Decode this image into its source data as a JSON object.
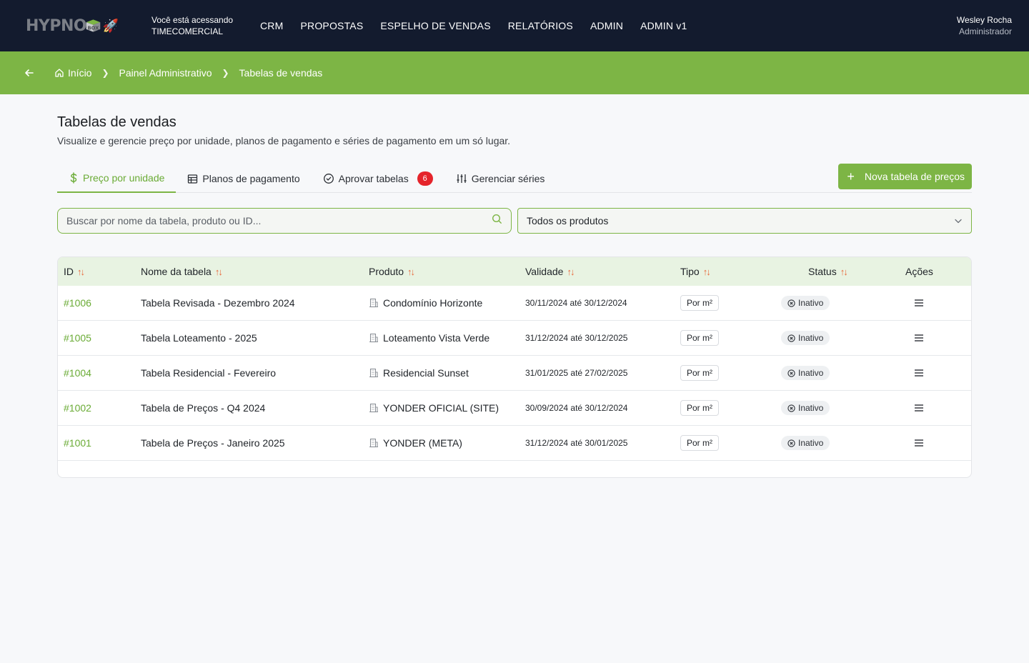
{
  "header": {
    "logo_alt": "HYPNOBOX",
    "access_line1": "Você está acessando",
    "access_line2": "TIMECOMERCIAL",
    "nav": [
      "CRM",
      "PROPOSTAS",
      "ESPELHO DE VENDAS",
      "RELATÓRIOS",
      "ADMIN",
      "ADMIN v1"
    ],
    "user_name": "Wesley Rocha",
    "user_role": "Administrador"
  },
  "breadcrumb": [
    "Início",
    "Painel Administrativo",
    "Tabelas de vendas"
  ],
  "page": {
    "title": "Tabelas de vendas",
    "subtitle": "Visualize e gerencie preço por unidade, planos de pagamento e séries de pagamento em um só lugar."
  },
  "tabs": [
    {
      "label": "Preço por unidade",
      "icon": "dollar-icon",
      "active": true
    },
    {
      "label": "Planos de pagamento",
      "icon": "table-icon",
      "active": false
    },
    {
      "label": "Aprovar tabelas",
      "icon": "check-circle-icon",
      "active": false,
      "badge": "6"
    },
    {
      "label": "Gerenciar séries",
      "icon": "sliders-icon",
      "active": false
    }
  ],
  "new_button": "Nova tabela de preços",
  "search": {
    "placeholder": "Buscar por nome da tabela, produto ou ID..."
  },
  "product_filter": {
    "selected": "Todos os produtos"
  },
  "table": {
    "columns": [
      "ID",
      "Nome da tabela",
      "Produto",
      "Validade",
      "Tipo",
      "Status",
      "Ações"
    ],
    "rows": [
      {
        "id": "#1006",
        "name": "Tabela Revisada - Dezembro 2024",
        "product": "Condomínio Horizonte",
        "validity": "30/11/2024 até 30/12/2024",
        "type": "Por m²",
        "status": "Inativo"
      },
      {
        "id": "#1005",
        "name": "Tabela Loteamento - 2025",
        "product": "Loteamento Vista Verde",
        "validity": "31/12/2024 até 30/12/2025",
        "type": "Por m²",
        "status": "Inativo"
      },
      {
        "id": "#1004",
        "name": "Tabela Residencial - Fevereiro",
        "product": "Residencial Sunset",
        "validity": "31/01/2025 até 27/02/2025",
        "type": "Por m²",
        "status": "Inativo"
      },
      {
        "id": "#1002",
        "name": "Tabela de Preços - Q4 2024",
        "product": "YONDER OFICIAL (SITE)",
        "validity": "30/09/2024 até 30/12/2024",
        "type": "Por m²",
        "status": "Inativo"
      },
      {
        "id": "#1001",
        "name": "Tabela de Preços - Janeiro 2025",
        "product": "YONDER (META)",
        "validity": "31/12/2024 até 30/01/2025",
        "type": "Por m²",
        "status": "Inativo"
      }
    ]
  },
  "colors": {
    "brand_green": "#7db545",
    "topbar": "#131b2e",
    "badge_red": "#e5242b",
    "sort_orange": "#e8683a"
  }
}
